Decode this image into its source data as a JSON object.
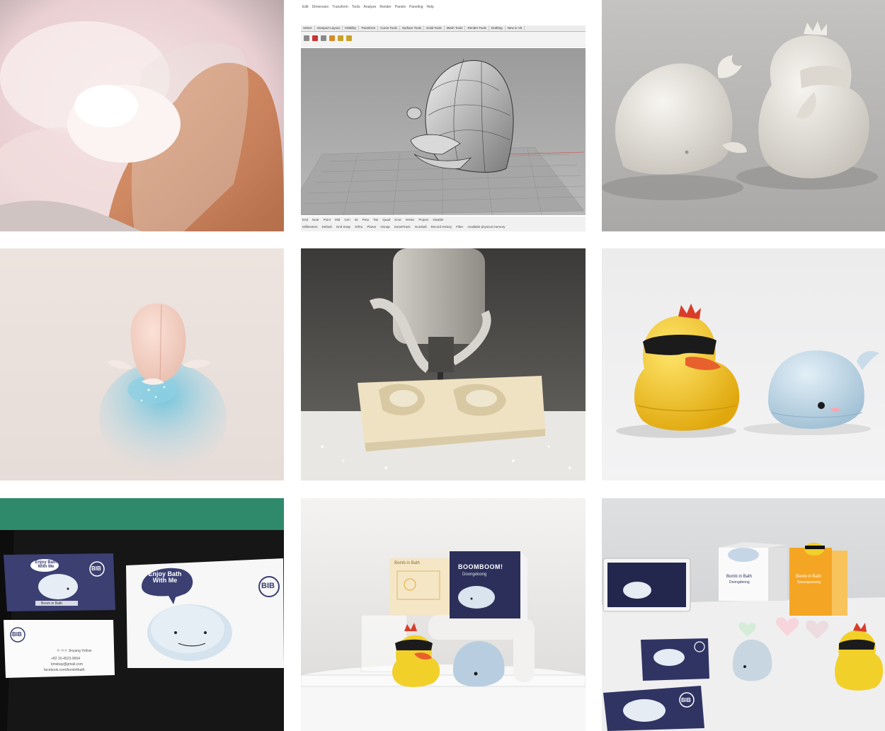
{
  "cad": {
    "menus": [
      "Edit",
      "Dimension",
      "Transform",
      "Tools",
      "Analyze",
      "Render",
      "Panels",
      "Paneling",
      "Help"
    ],
    "tabs": [
      "Select",
      "Viewport Layout",
      "Visibility",
      "Transform",
      "Curve Tools",
      "Surface Tools",
      "Solid Tools",
      "Mesh Tools",
      "Render Tools",
      "Drafting",
      "New in V5"
    ],
    "osnaps": [
      "End",
      "Near",
      "Point",
      "Mid",
      "Cen",
      "Int",
      "Perp",
      "Tan",
      "Quad",
      "Knot",
      "Vertex",
      "Project",
      "Disable"
    ],
    "status": [
      "Millimeters",
      "Default",
      "Grid Snap",
      "Ortho",
      "Planar",
      "Osnap",
      "SmartTrack",
      "Gumball",
      "Record History",
      "Filter",
      "Available physical memory"
    ]
  },
  "cards": {
    "bib_logo": "BIB",
    "bubble_small": "Enjoy Bath With Me",
    "bubble_large": "Enjoy Bath With Me",
    "brand_sub": "Boom in Bath",
    "card_name": "ㅇ ㅇㅇ Jinyang Yellow",
    "card_phone": "+82 10-4523-9664",
    "card_mail": "kmsbay@gmail.com",
    "card_fb": "facebook.com/bomb4bath"
  },
  "boxes": {
    "box_left_title": "Bomb in Bath",
    "box_mid_title": "BOOMBOOM!",
    "box_mid_sub": "Doongdoong"
  },
  "exhibit": {
    "box_whale_title": "Bomb in Bath",
    "box_whale_sub": "Doongdoong",
    "box_duck_title": "Bomb in Bath",
    "box_duck_sub": "Sseungsseung",
    "flyer_logo": "BIB"
  },
  "colors": {
    "duck_yellow": "#f2c81c",
    "whale_blue": "#b9d4e6",
    "card_navy": "#3b3f72",
    "bomb_pink": "#f3d3d4"
  }
}
